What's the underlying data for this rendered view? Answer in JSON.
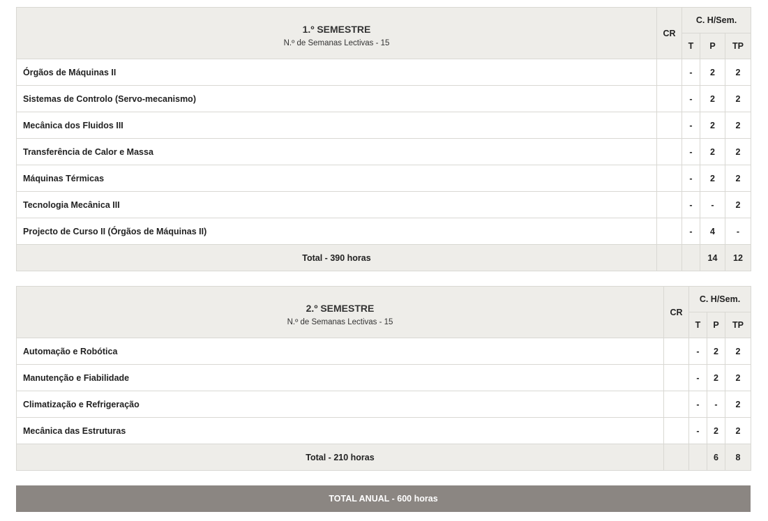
{
  "semesters": [
    {
      "title": "1.º SEMESTRE",
      "subtitle": "N.º de Semanas Lectivas - 15",
      "cr_label": "CR",
      "ch_label": "C. H/Sem.",
      "col_t": "T",
      "col_p": "P",
      "col_tp": "TP",
      "rows": [
        {
          "name": "Órgãos de Máquinas II",
          "cr": "",
          "t": "-",
          "p": "2",
          "tp": "2"
        },
        {
          "name": "Sistemas de Controlo (Servo-mecanismo)",
          "cr": "",
          "t": "-",
          "p": "2",
          "tp": "2"
        },
        {
          "name": "Mecânica dos Fluidos III",
          "cr": "",
          "t": "-",
          "p": "2",
          "tp": "2"
        },
        {
          "name": "Transferência de Calor e Massa",
          "cr": "",
          "t": "-",
          "p": "2",
          "tp": "2"
        },
        {
          "name": "Máquinas Térmicas",
          "cr": "",
          "t": "-",
          "p": "2",
          "tp": "2"
        },
        {
          "name": "Tecnologia Mecânica III",
          "cr": "",
          "t": "-",
          "p": "-",
          "tp": "2"
        },
        {
          "name": "Projecto de Curso II (Órgãos de Máquinas II)",
          "cr": "",
          "t": "-",
          "p": "4",
          "tp": "-"
        }
      ],
      "total": {
        "label": "Total - 390 horas",
        "cr": "",
        "t": "",
        "p": "14",
        "tp": "12"
      }
    },
    {
      "title": "2.º SEMESTRE",
      "subtitle": "N.º de Semanas Lectivas - 15",
      "cr_label": "CR",
      "ch_label": "C. H/Sem.",
      "col_t": "T",
      "col_p": "P",
      "col_tp": "TP",
      "rows": [
        {
          "name": "Automação e Robótica",
          "cr": "",
          "t": "-",
          "p": "2",
          "tp": "2"
        },
        {
          "name": "Manutenção e Fiabilidade",
          "cr": "",
          "t": "-",
          "p": "2",
          "tp": "2"
        },
        {
          "name": "Climatização e Refrigeração",
          "cr": "",
          "t": "-",
          "p": "-",
          "tp": "2"
        },
        {
          "name": "Mecânica das Estruturas",
          "cr": "",
          "t": "-",
          "p": "2",
          "tp": "2"
        }
      ],
      "total": {
        "label": "Total - 210 horas",
        "cr": "",
        "t": "",
        "p": "6",
        "tp": "8"
      }
    }
  ],
  "annual_total": "TOTAL ANUAL - 600 horas"
}
